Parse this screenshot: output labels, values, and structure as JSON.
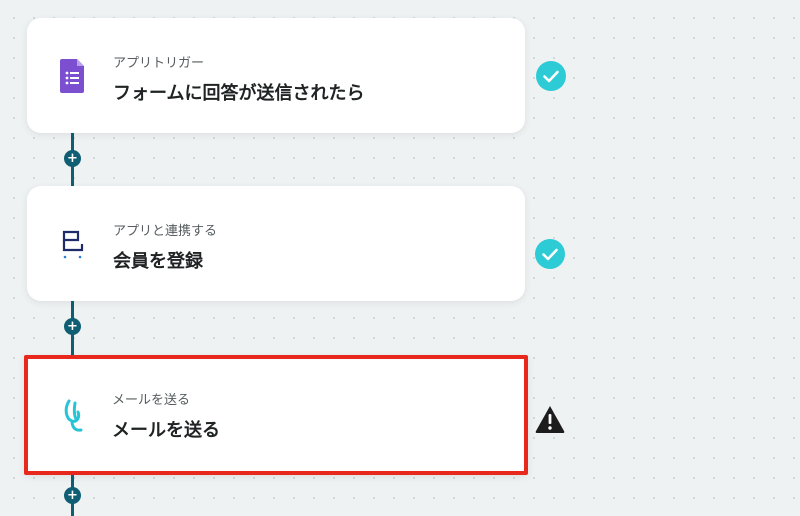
{
  "steps": [
    {
      "subtitle": "アプリトリガー",
      "title": "フォームに回答が送信されたら",
      "icon": "google-forms-icon",
      "status": "complete"
    },
    {
      "subtitle": "アプリと連携する",
      "title": "会員を登録",
      "icon": "app-logo-icon",
      "status": "complete"
    },
    {
      "subtitle": "メールを送る",
      "title": "メールを送る",
      "icon": "mail-script-icon",
      "status": "warning"
    }
  ],
  "add_step_label": "+",
  "colors": {
    "check": "#2ccbd5",
    "connector": "#0f5e73",
    "highlight": "#e8281c",
    "forms": "#7b4fcf",
    "warning": "#1d1d1d"
  }
}
